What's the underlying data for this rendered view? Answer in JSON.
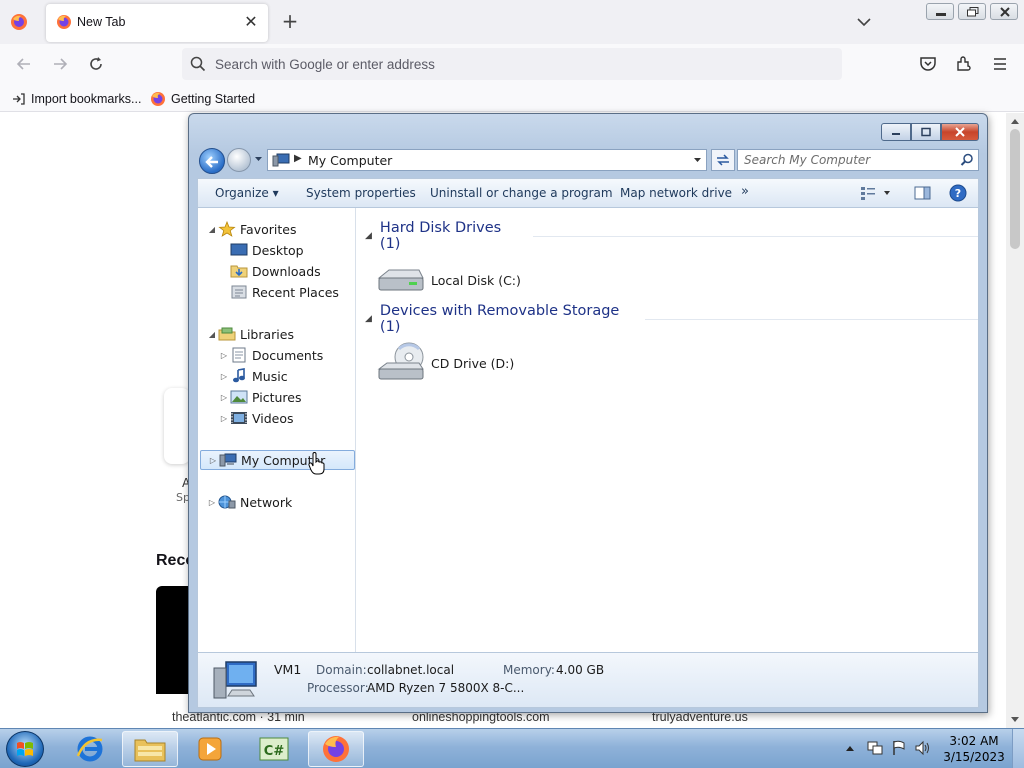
{
  "firefox": {
    "tab_title": "New Tab",
    "url_placeholder": "Search with Google or enter address",
    "bookmarks": [
      "Import bookmarks...",
      "Getting Started"
    ],
    "page": {
      "shortcut_label": "A",
      "shortcut_sub": "Sp",
      "recent_heading": "Reco",
      "recent_sources": [
        "theatlantic.com · 31 min",
        "onlineshoppingtools.com",
        "trulyadventure.us"
      ]
    }
  },
  "explorer": {
    "address": "My Computer",
    "search_placeholder": "Search My Computer",
    "commands": {
      "organize": "Organize",
      "system_properties": "System properties",
      "uninstall": "Uninstall or change a program",
      "map_drive": "Map network drive",
      "more": "»"
    },
    "nav": {
      "favorites": "Favorites",
      "desktop": "Desktop",
      "downloads": "Downloads",
      "recent_places": "Recent Places",
      "libraries": "Libraries",
      "documents": "Documents",
      "music": "Music",
      "pictures": "Pictures",
      "videos": "Videos",
      "my_computer": "My Computer",
      "network": "Network"
    },
    "groups": {
      "hdd": "Hard Disk Drives (1)",
      "removable": "Devices with Removable Storage (1)"
    },
    "drives": {
      "local_disk": "Local Disk (C:)",
      "cd_drive": "CD Drive (D:)"
    },
    "details": {
      "name": "VM1",
      "domain_label": "Domain:",
      "domain_value": "collabnet.local",
      "memory_label": "Memory:",
      "memory_value": "4.00 GB",
      "processor_label": "Processor:",
      "processor_value": "AMD Ryzen 7 5800X 8-C..."
    }
  },
  "taskbar": {
    "time": "3:02 AM",
    "date": "3/15/2023",
    "apps": [
      "internet-explorer",
      "file-explorer",
      "media-player",
      "csharp-app",
      "firefox"
    ]
  }
}
